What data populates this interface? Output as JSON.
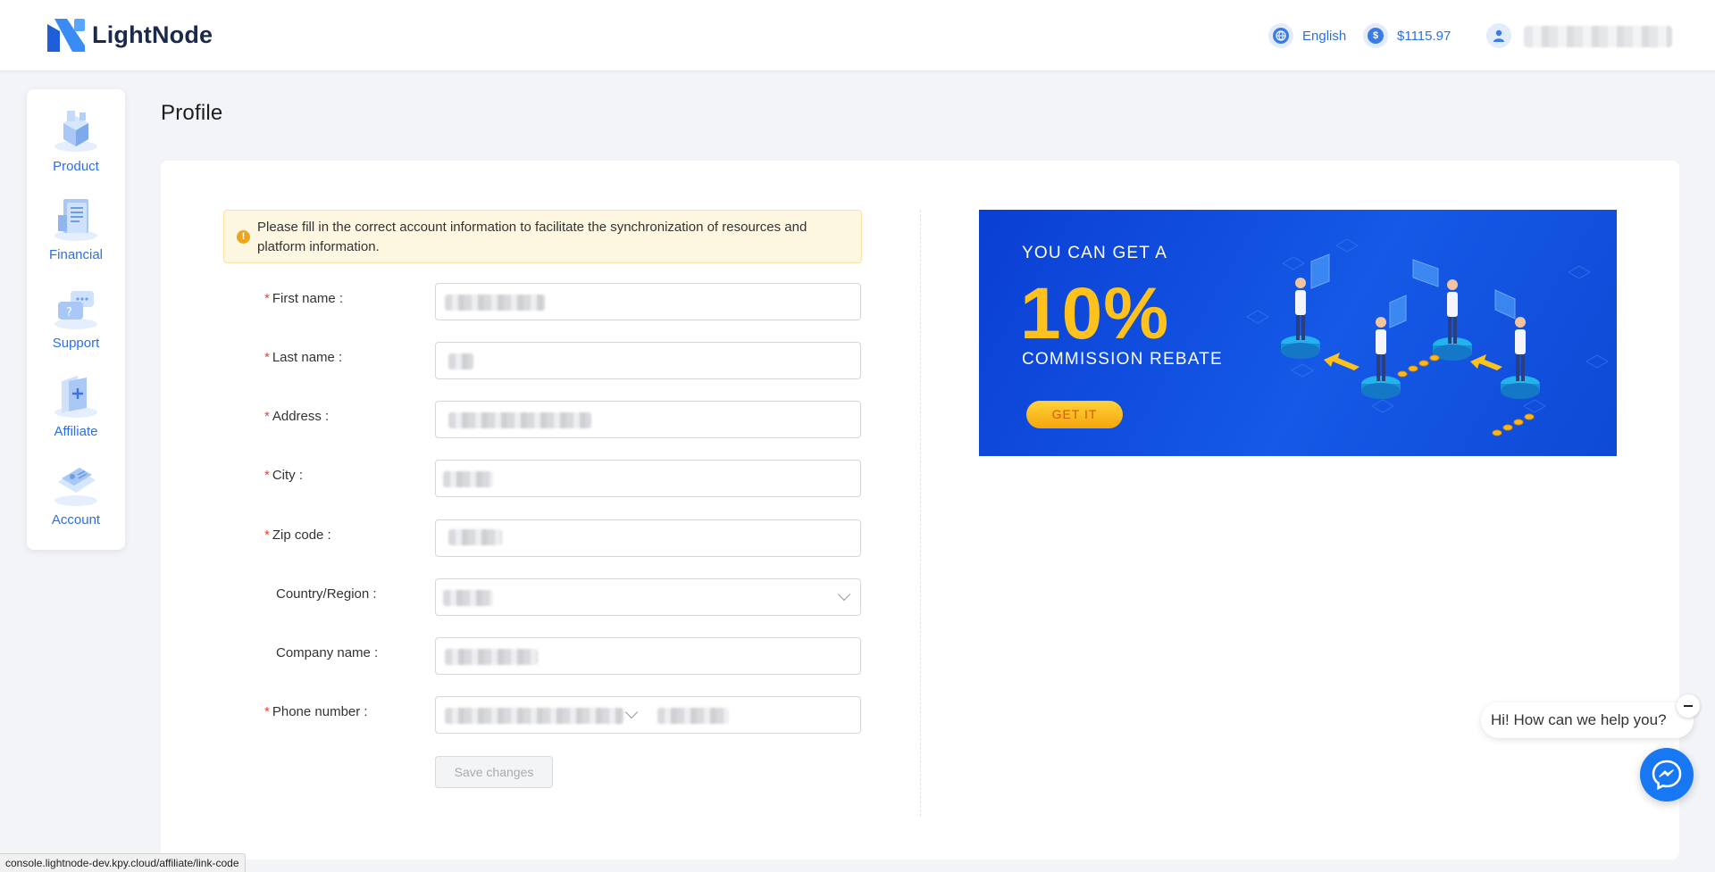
{
  "header": {
    "logo_text": "LightNode",
    "language_label": "English",
    "balance": "$1115.97",
    "icons": {
      "language": "globe-icon",
      "balance": "dollar-coin-icon",
      "user": "user-icon"
    }
  },
  "sidebar": {
    "items": [
      {
        "label": "Product",
        "icon": "server-cube-icon"
      },
      {
        "label": "Financial",
        "icon": "ledger-document-icon"
      },
      {
        "label": "Support",
        "icon": "chat-help-icon"
      },
      {
        "label": "Affiliate",
        "icon": "affiliate-card-icon"
      },
      {
        "label": "Account",
        "icon": "account-card-icon"
      }
    ]
  },
  "page": {
    "title": "Profile"
  },
  "alert": {
    "text": "Please fill in the correct account information to facilitate the synchronization of resources and platform information."
  },
  "form": {
    "fields": [
      {
        "label": "First name",
        "required": true
      },
      {
        "label": "Last name",
        "required": true
      },
      {
        "label": "Address",
        "required": true
      },
      {
        "label": "City",
        "required": true
      },
      {
        "label": "Zip code",
        "required": true
      },
      {
        "label": "Country/Region",
        "required": false
      },
      {
        "label": "Company name",
        "required": false
      },
      {
        "label": "Phone number",
        "required": true
      }
    ],
    "label_suffix": " :",
    "save_label": "Save changes"
  },
  "banner": {
    "line1": "YOU CAN GET A",
    "big": "10%",
    "line2": "COMMISSION REBATE",
    "button": "GET IT"
  },
  "chat": {
    "greeting": "Hi! How can we help you?"
  },
  "statusbar": {
    "url": "console.lightnode-dev.kpy.cloud/affiliate/link-code"
  },
  "colors": {
    "accent": "#2b6fe6",
    "required": "#f04134",
    "banner_yellow": "#ffc21d"
  }
}
